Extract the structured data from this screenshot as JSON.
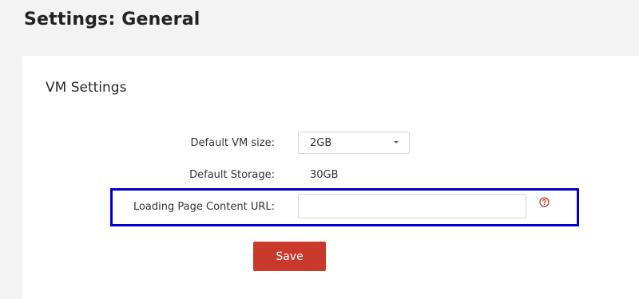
{
  "page": {
    "title": "Settings: General"
  },
  "vm_settings": {
    "heading": "VM Settings",
    "default_vm_size": {
      "label": "Default VM size:",
      "value": "2GB"
    },
    "default_storage": {
      "label": "Default Storage:",
      "value": "30GB"
    },
    "loading_page_url": {
      "label": "Loading Page Content URL:",
      "value": "",
      "placeholder": ""
    },
    "save_label": "Save"
  },
  "icons": {
    "dropdown": "chevron-down-icon",
    "help": "question-circle-icon"
  },
  "colors": {
    "save_button": "#c9392c",
    "help_icon": "#c9392c",
    "highlight_border": "#0000cc"
  }
}
